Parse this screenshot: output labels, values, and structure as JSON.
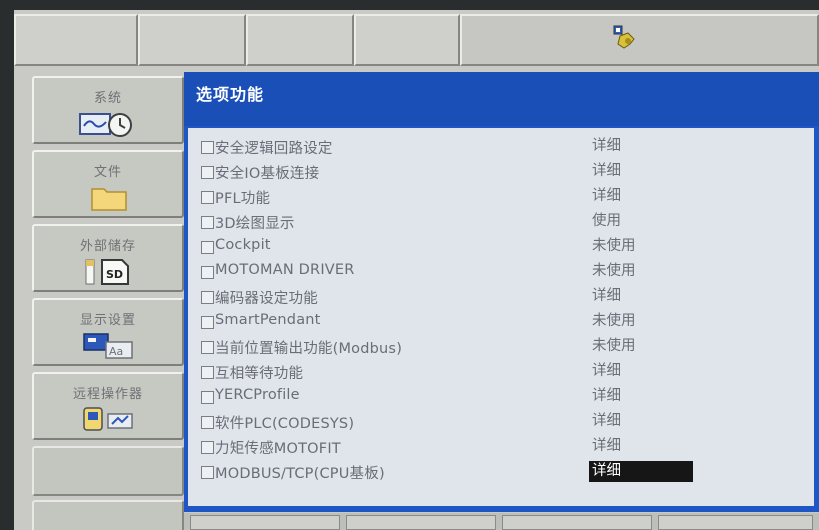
{
  "topbar": {
    "status_icon": "robot-status-icon"
  },
  "menu": {
    "items": [
      {
        "label": "系统",
        "icon": "system-clock-icon"
      },
      {
        "label": "文件",
        "icon": "folder-icon"
      },
      {
        "label": "外部储存",
        "icon": "sd-card-icon"
      },
      {
        "label": "显示设置",
        "icon": "display-settings-icon"
      },
      {
        "label": "远程操作器",
        "icon": "remote-operator-icon"
      }
    ]
  },
  "panel": {
    "title": "选项功能",
    "options": [
      {
        "name": "安全逻辑回路设定",
        "status": "详细"
      },
      {
        "name": "安全IO基板连接",
        "status": "详细"
      },
      {
        "name": "PFL功能",
        "status": "详细"
      },
      {
        "name": "3D绘图显示",
        "status": "使用"
      },
      {
        "name": "Cockpit",
        "status": "未使用"
      },
      {
        "name": "MOTOMAN DRIVER",
        "status": "未使用"
      },
      {
        "name": "编码器设定功能",
        "status": "详细"
      },
      {
        "name": "SmartPendant",
        "status": "未使用"
      },
      {
        "name": "当前位置输出功能(Modbus)",
        "status": "未使用"
      },
      {
        "name": "互相等待功能",
        "status": "详细"
      },
      {
        "name": "YERCProfile",
        "status": "详细"
      },
      {
        "name": "软件PLC(CODESYS)",
        "status": "详细"
      },
      {
        "name": "力矩传感MOTOFIT",
        "status": "详细"
      },
      {
        "name": "MODBUS/TCP(CPU基板)",
        "status": "详细",
        "selected": true
      }
    ]
  },
  "colors": {
    "title_bar": "#1b4fb8",
    "panel_bg": "#dfe5ea",
    "selection_bg": "#161616"
  }
}
